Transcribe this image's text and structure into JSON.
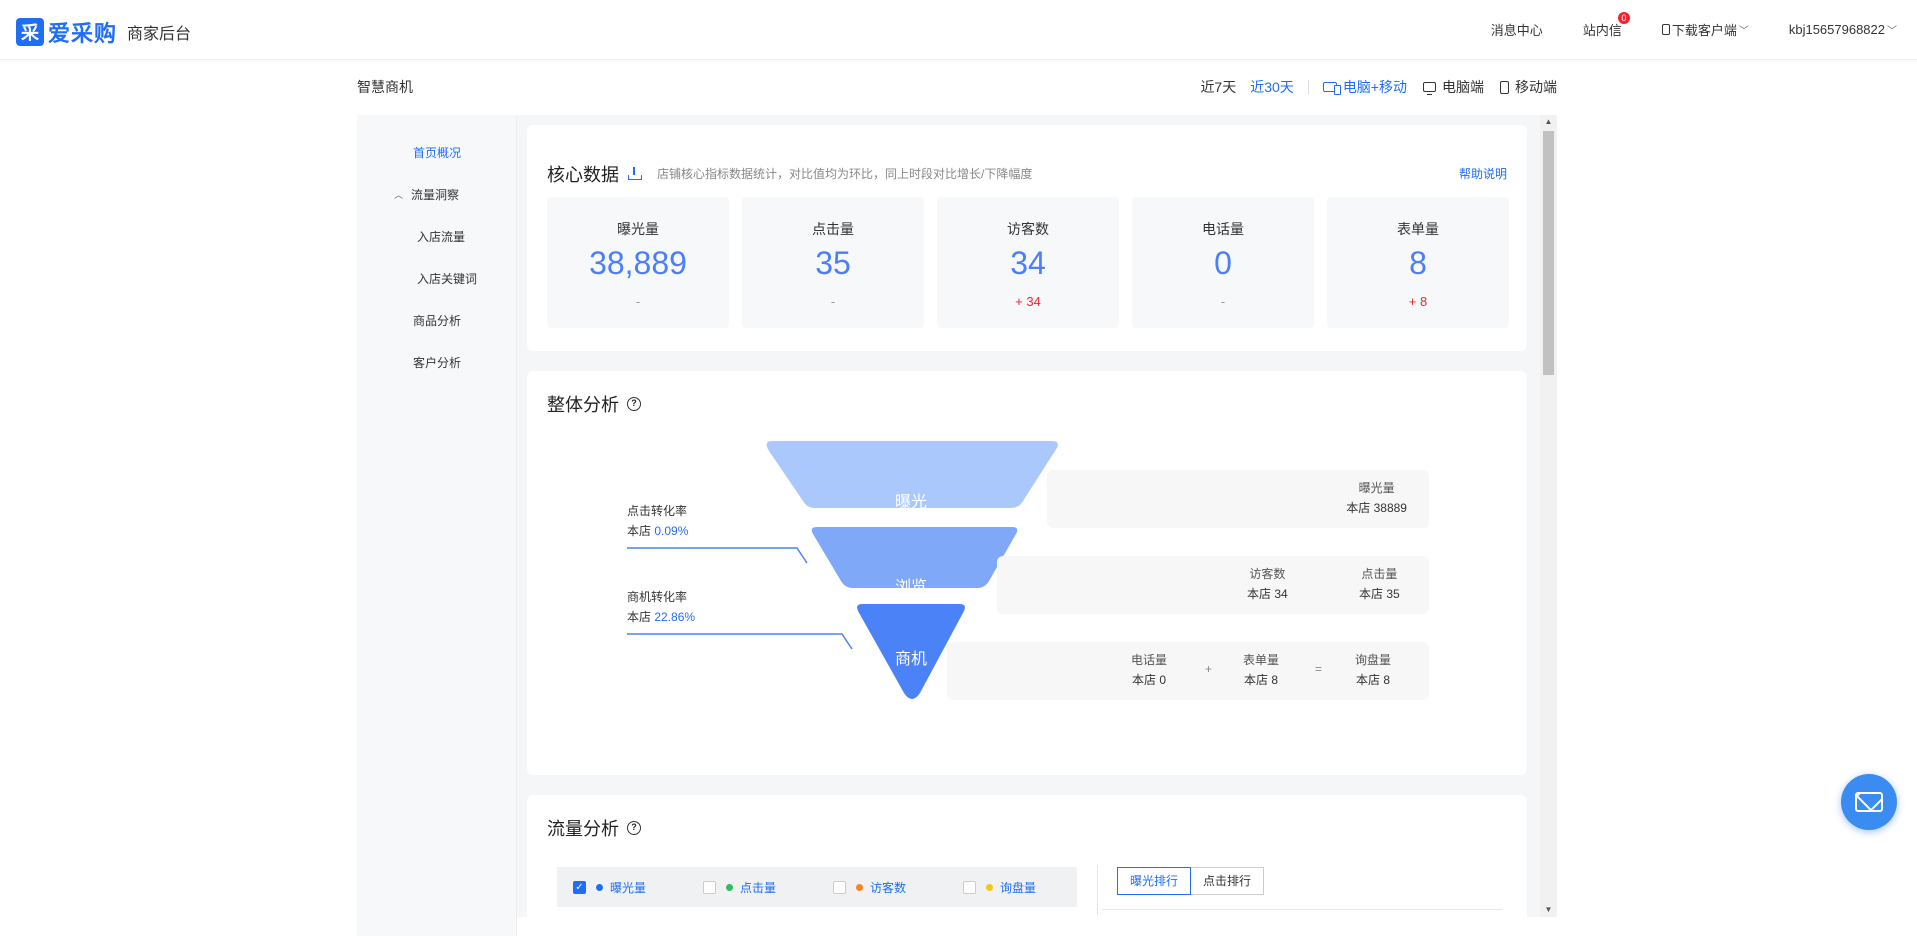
{
  "header": {
    "logo_mark": "采",
    "logo_text": "爱采购",
    "logo_sub": "商家后台",
    "nav": {
      "messages": "消息中心",
      "inbox": "站内信",
      "inbox_badge": "0",
      "download": "下载客户端",
      "account": "kbj15657968822"
    }
  },
  "subheader": {
    "title": "智慧商机",
    "ranges": [
      "近7天",
      "近30天"
    ],
    "active_range": "近30天",
    "devices": [
      "电脑+移动",
      "电脑端",
      "移动端"
    ],
    "active_device": "电脑+移动"
  },
  "sidebar": {
    "items": [
      {
        "label": "首页概况",
        "active": true
      },
      {
        "label": "流量洞察",
        "expanded": true
      },
      {
        "label": "入店流量"
      },
      {
        "label": "入店关键词"
      },
      {
        "label": "商品分析"
      },
      {
        "label": "客户分析"
      }
    ]
  },
  "core": {
    "title": "核心数据",
    "desc": "店铺核心指标数据统计，对比值均为环比，同上时段对比增长/下降幅度",
    "help": "帮助说明",
    "metrics": [
      {
        "label": "曝光量",
        "value": "38,889",
        "delta": "-"
      },
      {
        "label": "点击量",
        "value": "35",
        "delta": "-"
      },
      {
        "label": "访客数",
        "value": "34",
        "delta": "+ 34"
      },
      {
        "label": "电话量",
        "value": "0",
        "delta": "-"
      },
      {
        "label": "表单量",
        "value": "8",
        "delta": "+ 8"
      }
    ]
  },
  "overall": {
    "title": "整体分析",
    "help_icon": "?",
    "stages": [
      "曝光",
      "浏览",
      "商机"
    ],
    "rates": [
      {
        "label": "点击转化率",
        "prefix": "本店",
        "value": "0.09%"
      },
      {
        "label": "商机转化率",
        "prefix": "本店",
        "value": "22.86%"
      }
    ],
    "boxes": {
      "exposure": {
        "label": "曝光量",
        "value": "本店 38889"
      },
      "browse": [
        {
          "label": "访客数",
          "value": "本店 34"
        },
        {
          "label": "点击量",
          "value": "本店 35"
        }
      ],
      "business": [
        {
          "label": "电话量",
          "value": "本店 0"
        },
        {
          "label": "表单量",
          "value": "本店 8"
        },
        {
          "label": "询盘量",
          "value": "本店 8"
        }
      ],
      "plus": "+",
      "equals": "="
    }
  },
  "traffic": {
    "title": "流量分析",
    "help_icon": "?",
    "legend": [
      {
        "label": "曝光量",
        "checked": true,
        "color": "#1f6ef5"
      },
      {
        "label": "点击量",
        "checked": false,
        "color": "#2fbf5a"
      },
      {
        "label": "访客数",
        "checked": false,
        "color": "#f5842a"
      },
      {
        "label": "询盘量",
        "checked": false,
        "color": "#f5c518"
      }
    ],
    "check_mark": "✓",
    "rank_tabs": [
      "曝光排行",
      "点击排行"
    ]
  },
  "scroll": {
    "up": "▲",
    "down": "▼"
  }
}
